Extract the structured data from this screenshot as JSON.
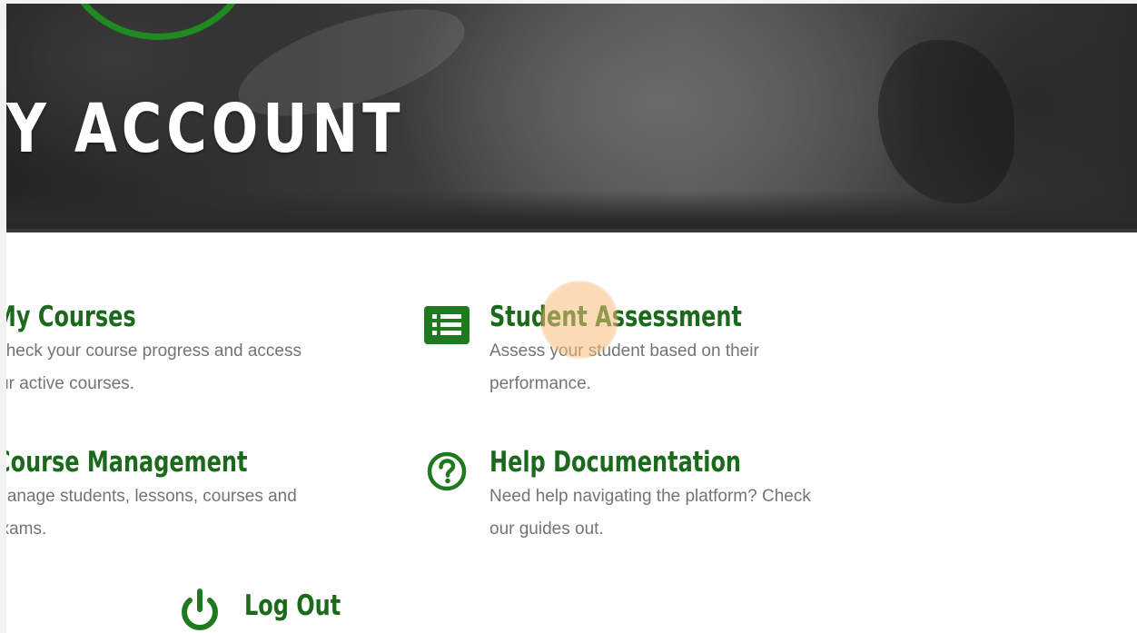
{
  "hero": {
    "title": "Y ACCOUNT"
  },
  "cards": {
    "my_courses": {
      "title": "My Courses",
      "description_line1": "Check your course progress and access",
      "description_line2": "your active courses."
    },
    "student_assessment": {
      "title": "Student Assessment",
      "description_line1": "Assess your student based on their",
      "description_line2": "performance.",
      "icon": "list-icon"
    },
    "course_management": {
      "title": "Course Management",
      "description_line1": "Manage students, lessons, courses and",
      "description_line2": "exams."
    },
    "help_documentation": {
      "title": "Help Documentation",
      "description_line1": "Need help navigating the platform? Check",
      "description_line2": "our guides out.",
      "icon": "question-circle-icon"
    },
    "log_out": {
      "title": "Log Out",
      "icon": "power-icon"
    }
  },
  "colors": {
    "brand_green": "#1b6a1b",
    "icon_green": "#1f7a1f",
    "text_gray": "#747474",
    "click_marker": "#f6be78"
  }
}
